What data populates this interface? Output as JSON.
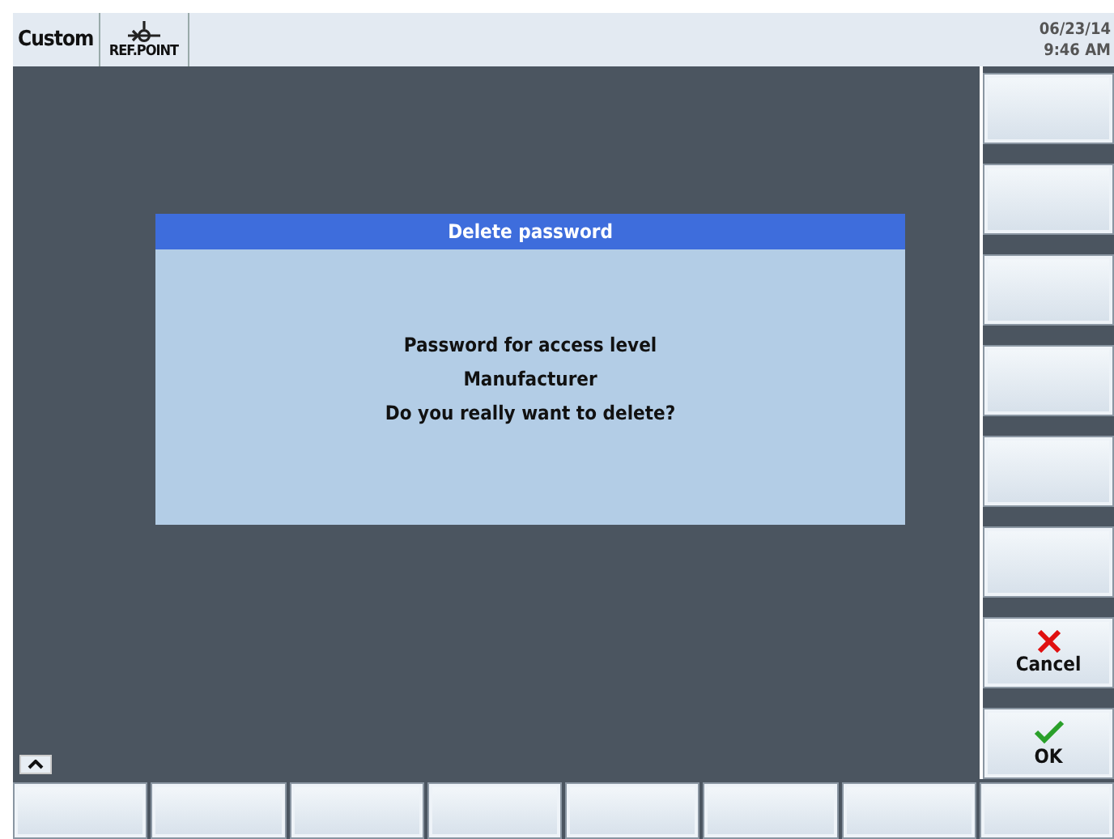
{
  "header": {
    "mode": "Custom",
    "status": "REF.POINT",
    "date": "06/23/14",
    "time": "9:46 AM"
  },
  "dialog": {
    "title": "Delete password",
    "lines": [
      "Password for access level",
      "Manufacturer",
      "Do you really want to delete?"
    ]
  },
  "vertical_softkeys": [
    {
      "kind": "blank"
    },
    {
      "kind": "blank"
    },
    {
      "kind": "blank"
    },
    {
      "kind": "blank"
    },
    {
      "kind": "blank"
    },
    {
      "kind": "blank"
    },
    {
      "kind": "cancel",
      "label": "Cancel"
    },
    {
      "kind": "ok",
      "label": "OK"
    }
  ],
  "horizontal_softkeys": [
    {
      "kind": "blank"
    },
    {
      "kind": "blank"
    },
    {
      "kind": "blank"
    },
    {
      "kind": "blank"
    },
    {
      "kind": "blank"
    },
    {
      "kind": "blank"
    },
    {
      "kind": "blank"
    },
    {
      "kind": "blank"
    }
  ]
}
